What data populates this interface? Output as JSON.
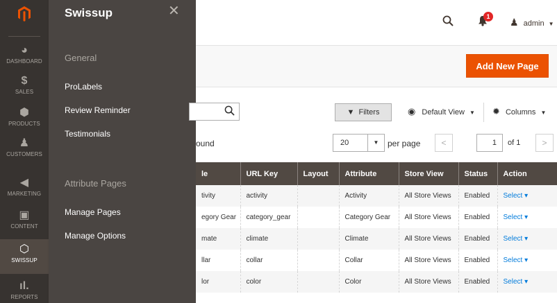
{
  "brand_color": "#eb5202",
  "nav": {
    "items": [
      {
        "label": "DASHBOARD",
        "icon": "dashboard-icon"
      },
      {
        "label": "SALES",
        "icon": "dollar-icon"
      },
      {
        "label": "PRODUCTS",
        "icon": "box-icon"
      },
      {
        "label": "CUSTOMERS",
        "icon": "person-icon"
      },
      {
        "label": "MARKETING",
        "icon": "megaphone-icon"
      },
      {
        "label": "CONTENT",
        "icon": "layout-icon"
      },
      {
        "label": "SWISSUP",
        "icon": "hexagon-icon"
      },
      {
        "label": "REPORTS",
        "icon": "bar-chart-icon"
      }
    ]
  },
  "flyout": {
    "title": "Swissup",
    "sections": [
      {
        "heading": "General",
        "links": [
          "ProLabels",
          "Review Reminder",
          "Testimonials"
        ]
      },
      {
        "heading": "Attribute Pages",
        "links": [
          "Manage Pages",
          "Manage Options"
        ]
      }
    ]
  },
  "header": {
    "notification_count": "1",
    "user": "admin"
  },
  "actions": {
    "add_new": "Add New Page"
  },
  "toolbar": {
    "filters": "Filters",
    "default_view": "Default View",
    "columns": "Columns",
    "found": "ound",
    "per_page_value": "20",
    "per_page_label": "per page",
    "page_value": "1",
    "page_of": "of 1"
  },
  "grid": {
    "headers": [
      "le",
      "URL Key",
      "Layout",
      "Attribute",
      "Store View",
      "Status",
      "Action"
    ],
    "rows": [
      [
        "tivity",
        "activity",
        "",
        "Activity",
        "All Store Views",
        "Enabled",
        "Select ▾"
      ],
      [
        "egory Gear",
        "category_gear",
        "",
        "Category Gear",
        "All Store Views",
        "Enabled",
        "Select ▾"
      ],
      [
        "mate",
        "climate",
        "",
        "Climate",
        "All Store Views",
        "Enabled",
        "Select ▾"
      ],
      [
        "llar",
        "collar",
        "",
        "Collar",
        "All Store Views",
        "Enabled",
        "Select ▾"
      ],
      [
        "lor",
        "color",
        "",
        "Color",
        "All Store Views",
        "Enabled",
        "Select ▾"
      ]
    ]
  }
}
